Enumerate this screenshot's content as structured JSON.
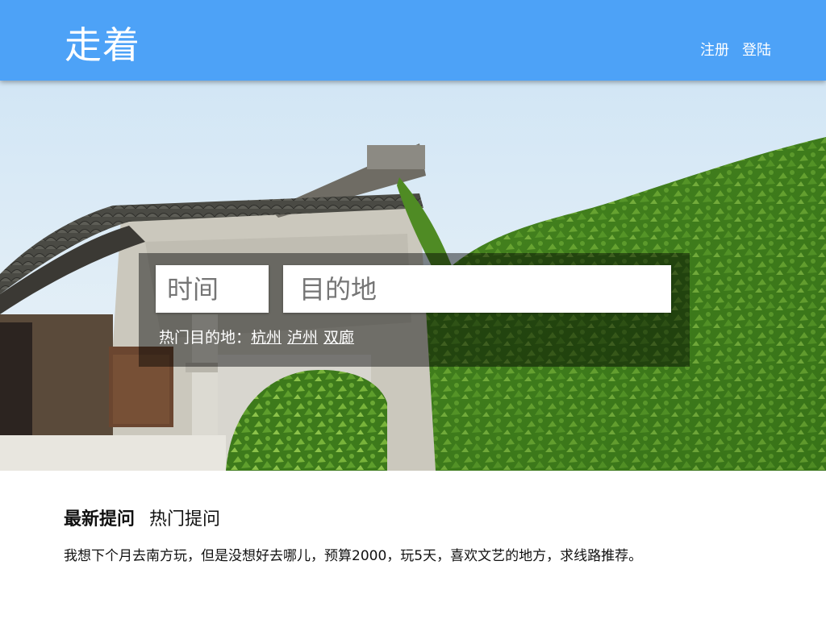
{
  "header": {
    "logo": "走着",
    "nav": {
      "register": "注册",
      "login": "登陆"
    },
    "colors": {
      "background": "#4da2f7"
    }
  },
  "search": {
    "time_placeholder": "时间",
    "destination_placeholder": "目的地",
    "hot_label": "热门目的地：",
    "hot_destinations": [
      "杭州",
      "泸州",
      "双廊"
    ]
  },
  "questions": {
    "tabs": [
      {
        "label": "最新提问",
        "active": true
      },
      {
        "label": "热门提问",
        "active": false
      }
    ],
    "items": [
      "我想下个月去南方玩，但是没想好去哪儿，预算2000，玩5天，喜欢文艺的地方，求线路推荐。"
    ]
  }
}
